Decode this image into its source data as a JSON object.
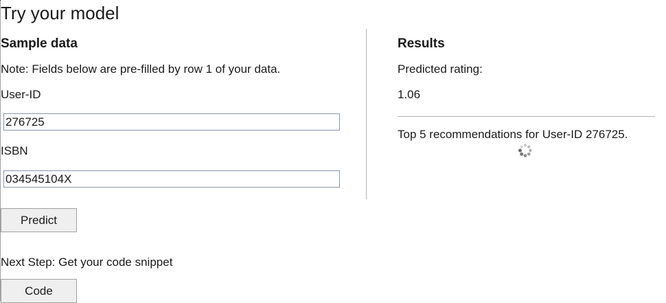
{
  "page": {
    "title": "Try your model"
  },
  "sample": {
    "heading": "Sample data",
    "note": "Note: Fields below are pre-filled by row 1 of your data.",
    "user_id_label": "User-ID",
    "user_id_value": "276725",
    "isbn_label": "ISBN",
    "isbn_value": "034545104X",
    "predict_label": "Predict"
  },
  "next_step": {
    "text": "Next Step: Get your code snippet",
    "code_label": "Code"
  },
  "results": {
    "heading": "Results",
    "predicted_label": "Predicted rating:",
    "predicted_value": "1.06",
    "recommendations_text": "Top 5 recommendations for User-ID 276725.",
    "loading_icon": "loading-spinner-icon"
  },
  "colors": {
    "divider": "#b5b5b5",
    "field_border": "#8a97a8",
    "button_bg": "#efefef"
  }
}
